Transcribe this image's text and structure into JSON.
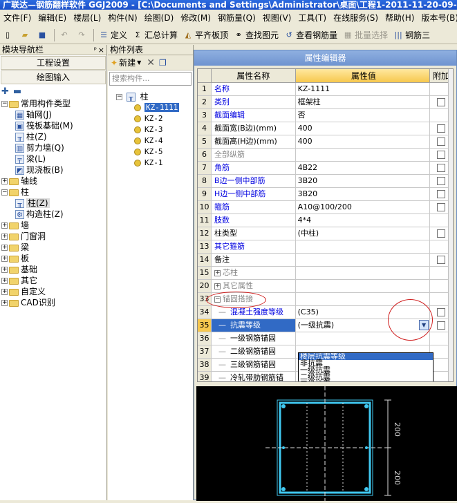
{
  "window": {
    "title": "广联达—钢筋翻样软件 GGJ2009 - [C:\\Documents and Settings\\Administrator\\桌面\\工程1-2011-11-20-09-"
  },
  "menu": [
    "文件(F)",
    "编辑(E)",
    "楼层(L)",
    "构件(N)",
    "绘图(D)",
    "修改(M)",
    "钢筋量(Q)",
    "视图(V)",
    "工具(T)",
    "在线服务(S)",
    "帮助(H)",
    "版本号(B)"
  ],
  "toolbar": {
    "define": "定义",
    "sum_calc": "汇总计算",
    "align_slab": "平齐板顶",
    "find_element": "查找图元",
    "view_rebar": "查看钢筋量",
    "batch_select": "批量选择",
    "rebar_3d": "钢筋三"
  },
  "nav": {
    "title": "模块导航栏",
    "pin": "ᵖ",
    "close": "×",
    "btn_project": "工程设置",
    "btn_draw": "绘图输入",
    "tree": [
      {
        "label": "常用构件类型",
        "level": 0,
        "type": "folder",
        "expanded": true
      },
      {
        "label": "轴网(J)",
        "level": 1,
        "type": "icon",
        "icon": "grid-icon"
      },
      {
        "label": "筏板基础(M)",
        "level": 1,
        "type": "icon",
        "icon": "raft-icon"
      },
      {
        "label": "柱(Z)",
        "level": 1,
        "type": "icon",
        "icon": "column-icon"
      },
      {
        "label": "剪力墙(Q)",
        "level": 1,
        "type": "icon",
        "icon": "wall-icon"
      },
      {
        "label": "梁(L)",
        "level": 1,
        "type": "icon",
        "icon": "beam-icon"
      },
      {
        "label": "现浇板(B)",
        "level": 1,
        "type": "icon",
        "icon": "slab-icon"
      },
      {
        "label": "轴线",
        "level": 0,
        "type": "folder",
        "expanded": false
      },
      {
        "label": "柱",
        "level": 0,
        "type": "folder",
        "expanded": true
      },
      {
        "label": "柱(Z)",
        "level": 1,
        "type": "icon",
        "icon": "column-icon",
        "selected": true
      },
      {
        "label": "构造柱(Z)",
        "level": 1,
        "type": "icon",
        "icon": "constructional-column-icon"
      },
      {
        "label": "墙",
        "level": 0,
        "type": "folder",
        "expanded": false
      },
      {
        "label": "门窗洞",
        "level": 0,
        "type": "folder",
        "expanded": false
      },
      {
        "label": "梁",
        "level": 0,
        "type": "folder",
        "expanded": false
      },
      {
        "label": "板",
        "level": 0,
        "type": "folder",
        "expanded": false
      },
      {
        "label": "基础",
        "level": 0,
        "type": "folder",
        "expanded": false
      },
      {
        "label": "其它",
        "level": 0,
        "type": "folder",
        "expanded": false
      },
      {
        "label": "自定义",
        "level": 0,
        "type": "folder",
        "expanded": false
      },
      {
        "label": "CAD识别",
        "level": 0,
        "type": "folder",
        "expanded": false
      }
    ]
  },
  "component_list": {
    "title": "构件列表",
    "new_label": "新建",
    "search_placeholder": "搜索构件...",
    "root": "柱",
    "items": [
      "KZ-1111",
      "KZ-2",
      "KZ-3",
      "KZ-4",
      "KZ-5",
      "KZ-1"
    ],
    "selected": "KZ-1111"
  },
  "property_editor": {
    "title": "属性编辑器",
    "headers": [
      "属性名称",
      "属性值",
      "附加"
    ],
    "rows": [
      {
        "no": "1",
        "name": "名称",
        "value": "KZ-1111",
        "color": "blue",
        "check": false
      },
      {
        "no": "2",
        "name": "类别",
        "value": "框架柱",
        "color": "blue",
        "check": true
      },
      {
        "no": "3",
        "name": "截面编辑",
        "value": "否",
        "color": "blue",
        "check": false
      },
      {
        "no": "4",
        "name": "截面宽(B边)(mm)",
        "value": "400",
        "color": "black",
        "check": true
      },
      {
        "no": "5",
        "name": "截面高(H边)(mm)",
        "value": "400",
        "color": "black",
        "check": true
      },
      {
        "no": "6",
        "name": "全部纵筋",
        "value": "",
        "color": "gray",
        "check": true
      },
      {
        "no": "7",
        "name": "角筋",
        "value": "4B22",
        "color": "blue",
        "check": true
      },
      {
        "no": "8",
        "name": "B边一侧中部筋",
        "value": "3B20",
        "color": "blue",
        "check": true
      },
      {
        "no": "9",
        "name": "H边一侧中部筋",
        "value": "3B20",
        "color": "blue",
        "check": true
      },
      {
        "no": "10",
        "name": "箍筋",
        "value": "A10@100/200",
        "color": "blue",
        "check": true
      },
      {
        "no": "11",
        "name": "肢数",
        "value": "4*4",
        "color": "blue",
        "check": false
      },
      {
        "no": "12",
        "name": "柱类型",
        "value": "(中柱)",
        "color": "black",
        "check": true
      },
      {
        "no": "13",
        "name": "其它箍筋",
        "value": "",
        "color": "blue",
        "check": false
      },
      {
        "no": "14",
        "name": "备注",
        "value": "",
        "color": "black",
        "check": true
      },
      {
        "no": "15",
        "name": "芯柱",
        "value": "",
        "color": "gray",
        "check": false,
        "group": true
      },
      {
        "no": "20",
        "name": "其它属性",
        "value": "",
        "color": "gray",
        "check": false,
        "group": true
      },
      {
        "no": "33",
        "name": "锚固搭接",
        "value": "",
        "color": "gray",
        "check": false,
        "group": true,
        "expanded": true
      },
      {
        "no": "34",
        "name": "混凝土强度等级",
        "value": "(C35)",
        "color": "blue",
        "check": true,
        "indent": true
      },
      {
        "no": "35",
        "name": "抗震等级",
        "value": "(一级抗震)",
        "color": "white",
        "check": true,
        "indent": true,
        "selected": true
      },
      {
        "no": "36",
        "name": "一级钢筋锚固",
        "value": "",
        "color": "black",
        "check": false,
        "indent": true
      },
      {
        "no": "37",
        "name": "二级钢筋锚固",
        "value": "",
        "color": "black",
        "check": false,
        "indent": true
      },
      {
        "no": "38",
        "name": "三级钢筋锚固",
        "value": "",
        "color": "black",
        "check": false,
        "indent": true
      },
      {
        "no": "39",
        "name": "冷轧带肋钢筋锚",
        "value": "",
        "color": "black",
        "check": false,
        "indent": true
      }
    ],
    "dropdown_options": [
      "楼层抗震等级",
      "非抗震",
      "一级抗震",
      "二级抗震",
      "三级抗震",
      "四级抗震"
    ],
    "dropdown_highlight": "楼层抗震等级"
  },
  "section_view": {
    "dim_right_top": "200",
    "dim_right_bottom": "200"
  },
  "colors": {
    "accent": "#316AC5",
    "header_gold": "#F7C84E",
    "annotation_red": "#D02020",
    "rebar_cyan": "#40C8F0"
  }
}
